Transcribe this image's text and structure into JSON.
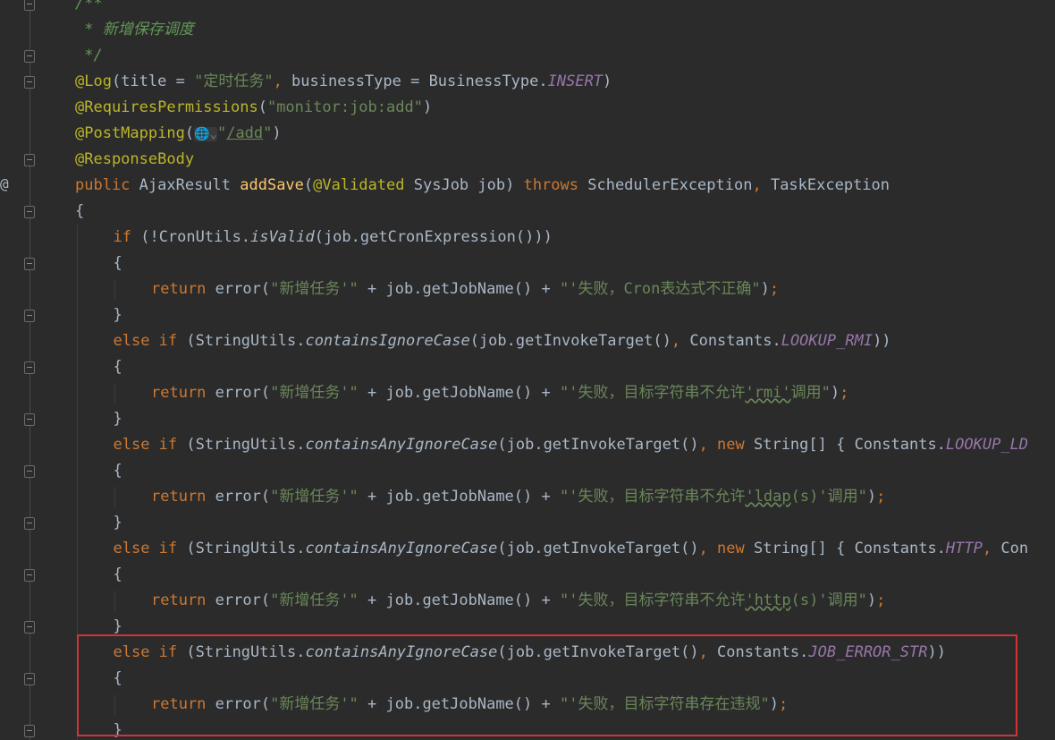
{
  "colors": {
    "background": "#2b2b2b",
    "keyword": "#cc7832",
    "annotation": "#bbb529",
    "string": "#6a8759",
    "text": "#a9b7c6",
    "comment": "#629755",
    "method_decl": "#ffc66d",
    "constant": "#9876aa",
    "highlight_box": "#d0343a"
  },
  "gutter": {
    "override_marker": "@",
    "fold_lines": [
      0,
      2,
      3,
      6,
      8,
      10,
      12,
      14,
      16,
      18,
      20,
      22,
      24,
      26,
      28
    ]
  },
  "code": {
    "lines": [
      {
        "indent": 0,
        "tokens": [
          [
            "c",
            "/**"
          ]
        ]
      },
      {
        "indent": 0,
        "tokens": [
          [
            "c",
            " * 新增保存调度"
          ]
        ]
      },
      {
        "indent": 0,
        "tokens": [
          [
            "c",
            " */"
          ]
        ]
      },
      {
        "indent": 0,
        "tokens": [
          [
            "a",
            "@Log"
          ],
          [
            "t",
            "(title = "
          ],
          [
            "s",
            "\"定时任务\""
          ],
          [
            "k",
            ", "
          ],
          [
            "t",
            "businessType = BusinessType."
          ],
          [
            "p",
            "INSERT"
          ],
          [
            "t",
            ")"
          ]
        ]
      },
      {
        "indent": 0,
        "tokens": [
          [
            "a",
            "@RequiresPermissions"
          ],
          [
            "t",
            "("
          ],
          [
            "s",
            "\"monitor:job:add\""
          ],
          [
            "t",
            ")"
          ]
        ]
      },
      {
        "indent": 0,
        "tokens": [
          [
            "a",
            "@PostMapping"
          ],
          [
            "t",
            "("
          ],
          [
            "g",
            "🌐⌄"
          ],
          [
            "s",
            "\""
          ],
          [
            "u",
            "/add"
          ],
          [
            "s",
            "\""
          ],
          [
            "t",
            ")"
          ]
        ]
      },
      {
        "indent": 0,
        "tokens": [
          [
            "a",
            "@ResponseBody"
          ]
        ]
      },
      {
        "indent": 0,
        "tokens": [
          [
            "k",
            "public "
          ],
          [
            "t",
            "AjaxResult "
          ],
          [
            "m",
            "addSave"
          ],
          [
            "t",
            "("
          ],
          [
            "a",
            "@Validated "
          ],
          [
            "t",
            "SysJob job) "
          ],
          [
            "k",
            "throws "
          ],
          [
            "t",
            "SchedulerException"
          ],
          [
            "k",
            ", "
          ],
          [
            "t",
            "TaskException"
          ]
        ]
      },
      {
        "indent": 0,
        "tokens": [
          [
            "t",
            "{"
          ]
        ]
      },
      {
        "indent": 1,
        "tokens": [
          [
            "k",
            "if "
          ],
          [
            "t",
            "(!CronUtils."
          ],
          [
            "i",
            "isValid"
          ],
          [
            "t",
            "(job.getCronExpression()))"
          ]
        ]
      },
      {
        "indent": 1,
        "tokens": [
          [
            "t",
            "{"
          ]
        ]
      },
      {
        "indent": 2,
        "tokens": [
          [
            "k",
            "return "
          ],
          [
            "t",
            "error("
          ],
          [
            "s",
            "\"新增任务'\""
          ],
          [
            "t",
            " + job.getJobName() + "
          ],
          [
            "s",
            "\"'失败，Cron表达式不正确\""
          ],
          [
            "t",
            ")"
          ],
          [
            "k",
            ";"
          ]
        ]
      },
      {
        "indent": 1,
        "tokens": [
          [
            "t",
            "}"
          ]
        ]
      },
      {
        "indent": 1,
        "tokens": [
          [
            "k",
            "else if "
          ],
          [
            "t",
            "(StringUtils."
          ],
          [
            "i",
            "containsIgnoreCase"
          ],
          [
            "t",
            "(job.getInvokeTarget()"
          ],
          [
            "k",
            ", "
          ],
          [
            "t",
            "Constants."
          ],
          [
            "p",
            "LOOKUP_RMI"
          ],
          [
            "t",
            "))"
          ]
        ]
      },
      {
        "indent": 1,
        "tokens": [
          [
            "t",
            "{"
          ]
        ]
      },
      {
        "indent": 2,
        "tokens": [
          [
            "k",
            "return "
          ],
          [
            "t",
            "error("
          ],
          [
            "s",
            "\"新增任务'\""
          ],
          [
            "t",
            " + job.getJobName() + "
          ],
          [
            "s",
            "\"'失败，目标字符串不允许"
          ],
          [
            "w",
            "'rmi'"
          ],
          [
            "s",
            "调用\""
          ],
          [
            "t",
            ")"
          ],
          [
            "k",
            ";"
          ]
        ]
      },
      {
        "indent": 1,
        "tokens": [
          [
            "t",
            "}"
          ]
        ]
      },
      {
        "indent": 1,
        "tokens": [
          [
            "k",
            "else if "
          ],
          [
            "t",
            "(StringUtils."
          ],
          [
            "i",
            "containsAnyIgnoreCase"
          ],
          [
            "t",
            "(job.getInvokeTarget()"
          ],
          [
            "k",
            ", new "
          ],
          [
            "t",
            "String[] { Constants."
          ],
          [
            "p",
            "LOOKUP_LD"
          ]
        ]
      },
      {
        "indent": 1,
        "tokens": [
          [
            "t",
            "{"
          ]
        ]
      },
      {
        "indent": 2,
        "tokens": [
          [
            "k",
            "return "
          ],
          [
            "t",
            "error("
          ],
          [
            "s",
            "\"新增任务'\""
          ],
          [
            "t",
            " + job.getJobName() + "
          ],
          [
            "s",
            "\"'失败，目标字符串不允许"
          ],
          [
            "w",
            "'ldap"
          ],
          [
            "s",
            "(s)'调用\""
          ],
          [
            "t",
            ")"
          ],
          [
            "k",
            ";"
          ]
        ]
      },
      {
        "indent": 1,
        "tokens": [
          [
            "t",
            "}"
          ]
        ]
      },
      {
        "indent": 1,
        "tokens": [
          [
            "k",
            "else if "
          ],
          [
            "t",
            "(StringUtils."
          ],
          [
            "i",
            "containsAnyIgnoreCase"
          ],
          [
            "t",
            "(job.getInvokeTarget()"
          ],
          [
            "k",
            ", new "
          ],
          [
            "t",
            "String[] { Constants."
          ],
          [
            "p",
            "HTTP"
          ],
          [
            "k",
            ", "
          ],
          [
            "t",
            "Con"
          ]
        ]
      },
      {
        "indent": 1,
        "tokens": [
          [
            "t",
            "{"
          ]
        ]
      },
      {
        "indent": 2,
        "tokens": [
          [
            "k",
            "return "
          ],
          [
            "t",
            "error("
          ],
          [
            "s",
            "\"新增任务'\""
          ],
          [
            "t",
            " + job.getJobName() + "
          ],
          [
            "s",
            "\"'失败，目标字符串不允许"
          ],
          [
            "w",
            "'http"
          ],
          [
            "s",
            "(s)'调用\""
          ],
          [
            "t",
            ")"
          ],
          [
            "k",
            ";"
          ]
        ]
      },
      {
        "indent": 1,
        "tokens": [
          [
            "t",
            "}"
          ]
        ]
      },
      {
        "indent": 1,
        "tokens": [
          [
            "k",
            "else if "
          ],
          [
            "t",
            "(StringUtils."
          ],
          [
            "i",
            "containsAnyIgnoreCase"
          ],
          [
            "t",
            "(job.getInvokeTarget()"
          ],
          [
            "k",
            ", "
          ],
          [
            "t",
            "Constants."
          ],
          [
            "p",
            "JOB_ERROR_STR"
          ],
          [
            "t",
            "))"
          ]
        ]
      },
      {
        "indent": 1,
        "tokens": [
          [
            "t",
            "{"
          ]
        ]
      },
      {
        "indent": 2,
        "tokens": [
          [
            "k",
            "return "
          ],
          [
            "t",
            "error("
          ],
          [
            "s",
            "\"新增任务'\""
          ],
          [
            "t",
            " + job.getJobName() + "
          ],
          [
            "s",
            "\"'失败，目标字符串存在违规\""
          ],
          [
            "t",
            ")"
          ],
          [
            "k",
            ";"
          ]
        ]
      },
      {
        "indent": 1,
        "tokens": [
          [
            "t",
            "}"
          ]
        ]
      }
    ]
  }
}
